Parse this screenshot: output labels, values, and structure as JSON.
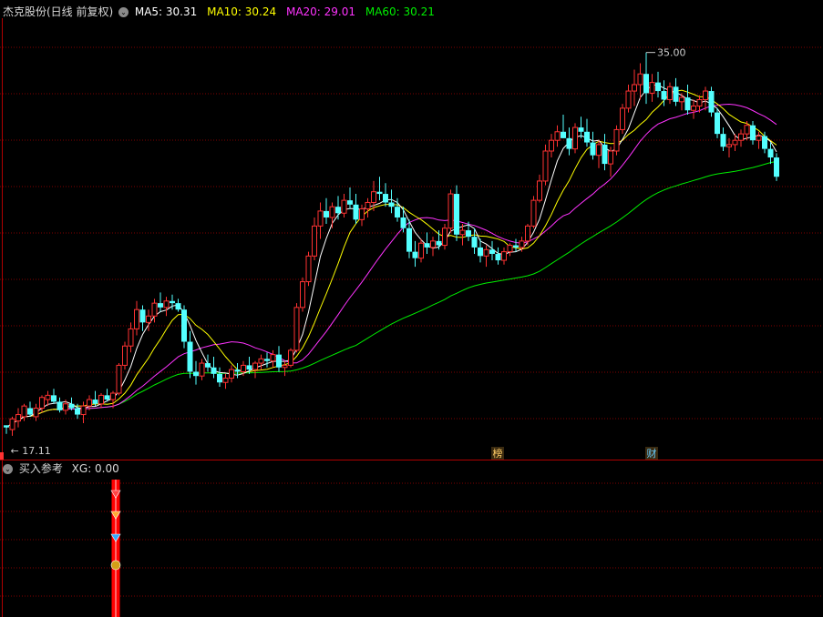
{
  "header": {
    "title": "杰克股份(日线 前复权)",
    "ma5": {
      "label": "MA5: 30.31",
      "color": "#ffffff"
    },
    "ma10": {
      "label": "MA10: 30.24",
      "color": "#ffff00"
    },
    "ma20": {
      "label": "MA20: 29.01",
      "color": "#ff33ff"
    },
    "ma60": {
      "label": "MA60: 30.21",
      "color": "#00ee00"
    }
  },
  "sub_header": {
    "title": "买入参考",
    "xg": "XG: 0.00"
  },
  "colors": {
    "up": "#ff3232",
    "down": "#54ffff",
    "grid": "#800000",
    "axis": "#b00000"
  },
  "chart_data": {
    "type": "candlestick",
    "title": "杰克股份(日线 前复权)",
    "annotations": [
      {
        "text": "35.00",
        "marker": "high",
        "value": 35.0
      },
      {
        "text": "17.11",
        "marker": "low",
        "value": 17.11
      }
    ],
    "event_markers": [
      "榜",
      "财"
    ],
    "ylim": [
      16.0,
      36.6
    ],
    "ohlc": [
      [
        17.6,
        17.6,
        17.2,
        17.5
      ],
      [
        17.4,
        18.0,
        17.11,
        17.9
      ],
      [
        17.8,
        18.4,
        17.5,
        18.1
      ],
      [
        18.0,
        18.6,
        17.8,
        18.5
      ],
      [
        18.4,
        18.7,
        18.0,
        18.1
      ],
      [
        18.0,
        18.6,
        17.8,
        18.4
      ],
      [
        18.4,
        19.0,
        18.2,
        18.9
      ],
      [
        18.8,
        19.2,
        18.5,
        19.0
      ],
      [
        19.0,
        19.3,
        18.6,
        18.7
      ],
      [
        18.7,
        18.9,
        18.2,
        18.3
      ],
      [
        18.3,
        18.8,
        18.1,
        18.6
      ],
      [
        18.6,
        18.9,
        18.3,
        18.4
      ],
      [
        18.4,
        18.6,
        17.9,
        18.1
      ],
      [
        18.1,
        18.7,
        17.7,
        18.5
      ],
      [
        18.5,
        19.0,
        18.3,
        18.8
      ],
      [
        18.8,
        19.2,
        18.5,
        18.6
      ],
      [
        18.6,
        19.1,
        18.4,
        19.0
      ],
      [
        19.0,
        19.3,
        18.7,
        18.8
      ],
      [
        18.8,
        19.2,
        18.4,
        19.1
      ],
      [
        19.1,
        20.5,
        19.0,
        20.4
      ],
      [
        20.4,
        21.5,
        20.2,
        21.3
      ],
      [
        21.3,
        22.4,
        21.0,
        22.1
      ],
      [
        22.1,
        23.4,
        21.8,
        23.0
      ],
      [
        23.0,
        23.2,
        22.0,
        22.4
      ],
      [
        22.4,
        23.0,
        22.0,
        22.7
      ],
      [
        22.7,
        23.5,
        22.4,
        23.3
      ],
      [
        23.3,
        23.8,
        22.9,
        23.1
      ],
      [
        23.1,
        23.6,
        22.7,
        23.4
      ],
      [
        23.4,
        23.7,
        23.0,
        23.3
      ],
      [
        23.3,
        23.5,
        22.9,
        23.0
      ],
      [
        23.0,
        23.2,
        21.2,
        21.5
      ],
      [
        21.5,
        22.0,
        19.8,
        20.1
      ],
      [
        20.1,
        20.6,
        19.5,
        19.9
      ],
      [
        19.9,
        20.7,
        19.7,
        20.5
      ],
      [
        20.5,
        20.9,
        20.1,
        20.3
      ],
      [
        20.3,
        20.8,
        19.8,
        20.0
      ],
      [
        20.0,
        20.3,
        19.4,
        19.6
      ],
      [
        19.6,
        20.0,
        19.3,
        19.8
      ],
      [
        19.8,
        20.4,
        19.6,
        20.2
      ],
      [
        20.2,
        20.5,
        19.8,
        20.1
      ],
      [
        20.1,
        20.6,
        19.9,
        20.4
      ],
      [
        20.4,
        20.8,
        20.0,
        20.2
      ],
      [
        20.2,
        20.6,
        19.8,
        20.5
      ],
      [
        20.5,
        20.9,
        20.2,
        20.7
      ],
      [
        20.7,
        21.0,
        20.3,
        20.6
      ],
      [
        20.6,
        21.1,
        20.3,
        20.9
      ],
      [
        20.9,
        21.3,
        20.1,
        20.3
      ],
      [
        20.3,
        20.6,
        19.9,
        20.4
      ],
      [
        20.4,
        21.2,
        20.3,
        21.1
      ],
      [
        21.1,
        23.3,
        21.0,
        23.1
      ],
      [
        23.1,
        24.5,
        22.9,
        24.3
      ],
      [
        24.3,
        25.7,
        24.1,
        25.5
      ],
      [
        25.5,
        27.3,
        25.3,
        26.9
      ],
      [
        26.9,
        28.0,
        26.3,
        27.6
      ],
      [
        27.6,
        28.2,
        27.0,
        27.3
      ],
      [
        27.3,
        28.0,
        26.8,
        27.8
      ],
      [
        27.8,
        28.3,
        27.2,
        27.5
      ],
      [
        27.5,
        28.4,
        27.3,
        28.1
      ],
      [
        28.1,
        28.7,
        27.7,
        27.9
      ],
      [
        27.9,
        28.4,
        27.0,
        27.2
      ],
      [
        27.2,
        27.9,
        26.9,
        27.7
      ],
      [
        27.7,
        28.2,
        27.3,
        28.0
      ],
      [
        28.0,
        29.0,
        27.6,
        28.5
      ],
      [
        28.5,
        29.2,
        28.1,
        28.4
      ],
      [
        28.4,
        28.9,
        27.8,
        28.0
      ],
      [
        28.0,
        28.6,
        27.5,
        27.8
      ],
      [
        27.8,
        28.2,
        27.1,
        27.3
      ],
      [
        27.3,
        27.8,
        26.6,
        26.8
      ],
      [
        26.8,
        27.2,
        25.4,
        25.7
      ],
      [
        25.7,
        26.2,
        25.0,
        25.4
      ],
      [
        25.4,
        26.3,
        25.2,
        26.1
      ],
      [
        26.1,
        26.6,
        25.6,
        25.9
      ],
      [
        25.9,
        26.4,
        25.5,
        26.2
      ],
      [
        26.2,
        26.7,
        25.8,
        26.0
      ],
      [
        26.0,
        27.0,
        25.8,
        26.8
      ],
      [
        26.8,
        28.6,
        26.6,
        28.4
      ],
      [
        28.4,
        28.8,
        26.2,
        26.5
      ],
      [
        26.5,
        27.0,
        26.0,
        26.7
      ],
      [
        26.7,
        27.1,
        26.2,
        26.4
      ],
      [
        26.4,
        26.8,
        25.6,
        25.9
      ],
      [
        25.9,
        26.3,
        25.2,
        25.5
      ],
      [
        25.5,
        26.0,
        25.0,
        25.8
      ],
      [
        25.8,
        26.2,
        25.3,
        25.6
      ],
      [
        25.6,
        25.9,
        25.1,
        25.3
      ],
      [
        25.3,
        25.9,
        25.1,
        25.7
      ],
      [
        25.7,
        26.1,
        25.5,
        26.0
      ],
      [
        26.0,
        26.3,
        25.7,
        25.9
      ],
      [
        25.9,
        26.4,
        25.7,
        26.2
      ],
      [
        26.2,
        27.0,
        26.0,
        26.9
      ],
      [
        26.9,
        28.3,
        26.8,
        28.1
      ],
      [
        28.1,
        29.3,
        28.0,
        29.0
      ],
      [
        29.0,
        30.7,
        28.8,
        30.4
      ],
      [
        30.4,
        31.2,
        30.1,
        30.9
      ],
      [
        30.9,
        31.6,
        30.6,
        31.3
      ],
      [
        31.3,
        32.1,
        31.0,
        31.0
      ],
      [
        31.0,
        31.5,
        30.2,
        30.5
      ],
      [
        30.5,
        31.7,
        30.3,
        31.5
      ],
      [
        31.5,
        32.0,
        31.0,
        31.3
      ],
      [
        31.3,
        31.9,
        30.6,
        30.8
      ],
      [
        30.8,
        31.3,
        30.0,
        30.2
      ],
      [
        30.2,
        30.9,
        29.6,
        30.7
      ],
      [
        30.7,
        31.2,
        29.5,
        29.8
      ],
      [
        29.8,
        30.6,
        29.2,
        30.4
      ],
      [
        30.4,
        31.6,
        30.2,
        31.4
      ],
      [
        31.4,
        32.6,
        31.2,
        32.4
      ],
      [
        32.4,
        33.5,
        32.2,
        33.2
      ],
      [
        33.2,
        34.2,
        32.5,
        33.5
      ],
      [
        33.5,
        34.5,
        32.8,
        34.0
      ],
      [
        34.0,
        35.0,
        32.6,
        33.1
      ],
      [
        33.1,
        34.0,
        32.7,
        33.6
      ],
      [
        33.6,
        34.1,
        32.9,
        33.2
      ],
      [
        33.2,
        33.7,
        32.5,
        32.8
      ],
      [
        32.8,
        33.6,
        32.6,
        33.4
      ],
      [
        33.4,
        33.8,
        32.5,
        32.7
      ],
      [
        32.7,
        33.1,
        32.3,
        32.9
      ],
      [
        32.9,
        33.5,
        32.1,
        32.3
      ],
      [
        32.3,
        32.8,
        31.9,
        32.5
      ],
      [
        32.5,
        33.0,
        32.2,
        32.8
      ],
      [
        32.8,
        33.4,
        32.3,
        33.2
      ],
      [
        33.2,
        33.4,
        32.0,
        32.2
      ],
      [
        32.2,
        32.4,
        31.0,
        31.2
      ],
      [
        31.2,
        31.5,
        30.4,
        30.6
      ],
      [
        30.6,
        31.0,
        30.1,
        30.7
      ],
      [
        30.7,
        31.2,
        30.4,
        30.9
      ],
      [
        30.9,
        31.4,
        30.6,
        31.2
      ],
      [
        31.2,
        31.8,
        30.9,
        31.6
      ],
      [
        31.6,
        31.8,
        30.7,
        30.9
      ],
      [
        30.9,
        31.3,
        30.5,
        31.1
      ],
      [
        31.1,
        31.3,
        30.3,
        30.5
      ],
      [
        30.5,
        30.8,
        29.8,
        30.1
      ],
      [
        30.1,
        30.3,
        29.0,
        29.2
      ]
    ],
    "series": [
      {
        "name": "MA5",
        "value": 30.31
      },
      {
        "name": "MA10",
        "value": 30.24
      },
      {
        "name": "MA20",
        "value": 29.01
      },
      {
        "name": "MA60",
        "value": 30.21
      }
    ],
    "indicator": {
      "title": "买入参考",
      "label": "XG: 0.00",
      "signal_index": 23
    }
  }
}
